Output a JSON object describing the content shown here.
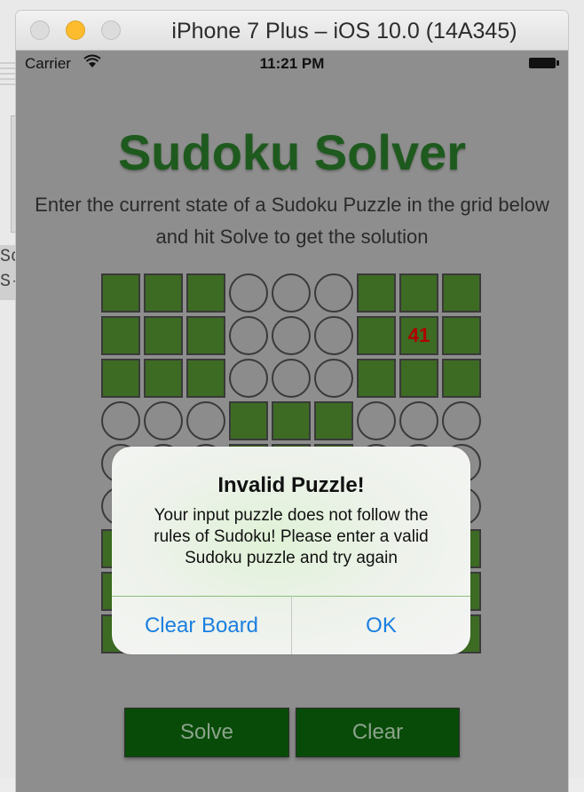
{
  "window": {
    "title": "iPhone 7 Plus – iOS 10.0 (14A345)"
  },
  "desktop": {
    "fragment_text": "Sc\nS-("
  },
  "status_bar": {
    "carrier": "Carrier",
    "time": "11:21 PM"
  },
  "app": {
    "title": "Sudoku Solver",
    "subtitle": "Enter the current state of a Sudoku Puzzle in the grid below and hit Solve to get the solution"
  },
  "grid": {
    "colors": {
      "dark": "#3d6b23",
      "light": "#8c8c8c",
      "value_text": "#b00000"
    },
    "rows": [
      [
        "",
        "",
        "",
        "",
        "",
        "",
        "",
        "",
        ""
      ],
      [
        "",
        "",
        "",
        "",
        "",
        "",
        "",
        "41",
        ""
      ],
      [
        "",
        "",
        "",
        "",
        "",
        "",
        "",
        "",
        ""
      ],
      [
        "",
        "",
        "",
        "",
        "",
        "",
        "",
        "",
        ""
      ],
      [
        "",
        "",
        "",
        "",
        "",
        "",
        "",
        "",
        ""
      ],
      [
        "",
        "",
        "",
        "",
        "",
        "",
        "",
        "",
        ""
      ],
      [
        "",
        "",
        "",
        "",
        "",
        "",
        "",
        "",
        ""
      ],
      [
        "",
        "",
        "",
        "",
        "",
        "",
        "",
        "",
        ""
      ],
      [
        "",
        "",
        "",
        "",
        "",
        "",
        "",
        "",
        ""
      ]
    ]
  },
  "buttons": {
    "solve": "Solve",
    "clear": "Clear"
  },
  "alert": {
    "title": "Invalid Puzzle!",
    "message": "Your input puzzle does not follow the\nrules of Sudoku! Please enter a valid\nSudoku puzzle and try again",
    "clear_board": "Clear Board",
    "ok": "OK",
    "button_color": "#1a7fe0"
  },
  "theme": {
    "title_green": "#1e5a1e",
    "button_green": "#084b08",
    "screen_dim": "#8e8e8e"
  }
}
